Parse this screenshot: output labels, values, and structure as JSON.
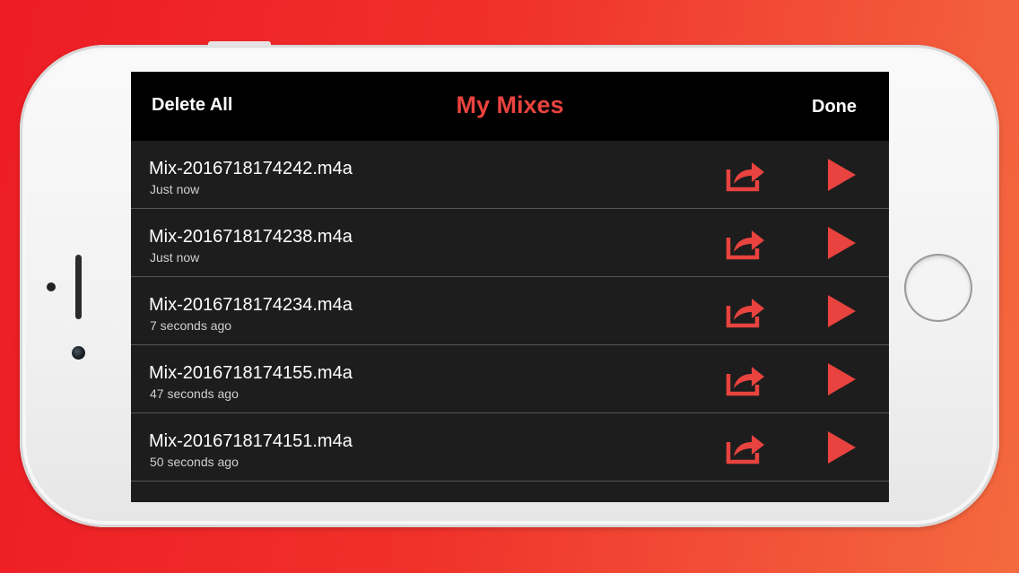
{
  "navbar": {
    "left_label": "Delete All",
    "title": "My Mixes",
    "right_label": "Done"
  },
  "mixes": [
    {
      "name": "Mix-2016718174242.m4a",
      "time": "Just now"
    },
    {
      "name": "Mix-2016718174238.m4a",
      "time": "Just now"
    },
    {
      "name": "Mix-2016718174234.m4a",
      "time": "7 seconds ago"
    },
    {
      "name": "Mix-2016718174155.m4a",
      "time": "47 seconds ago"
    },
    {
      "name": "Mix-2016718174151.m4a",
      "time": "50 seconds ago"
    }
  ],
  "icons": {
    "share": "share-icon",
    "play": "play-icon"
  },
  "colors": {
    "accent": "#e8433f",
    "nav_background": "#000000",
    "list_background": "#1d1d1d",
    "background_gradient_start": "#ee1c25",
    "background_gradient_end": "#f46a3e"
  }
}
